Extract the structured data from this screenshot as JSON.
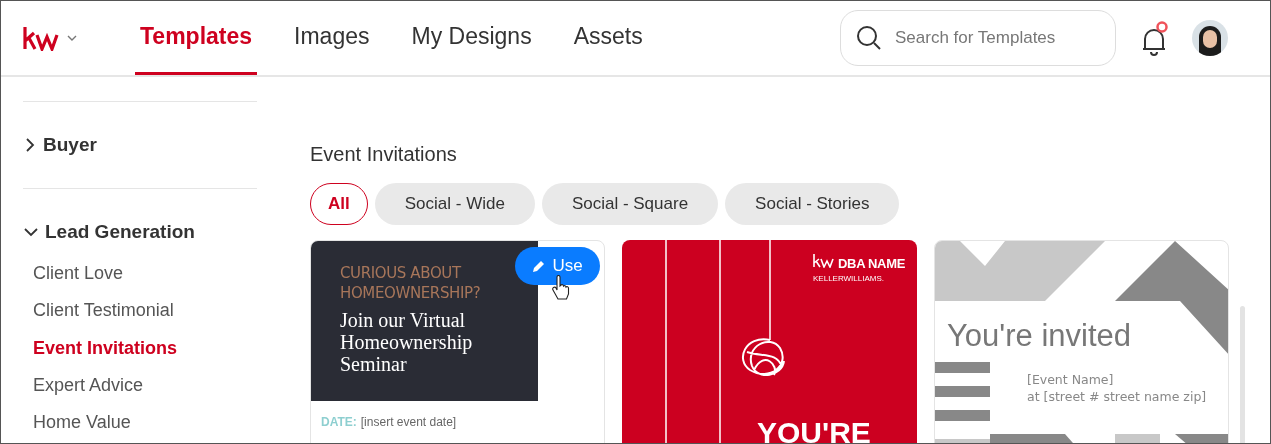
{
  "nav": {
    "tabs": [
      {
        "label": "Templates",
        "selected": true
      },
      {
        "label": "Images",
        "selected": false
      },
      {
        "label": "My Designs",
        "selected": false
      },
      {
        "label": "Assets",
        "selected": false
      }
    ],
    "search": {
      "placeholder": "Search for Templates"
    },
    "notifications": {
      "unread": true
    }
  },
  "sidebar": {
    "sections": [
      {
        "label": "Buyer",
        "expanded": false
      },
      {
        "label": "Lead Generation",
        "expanded": true,
        "children": [
          {
            "label": "Client Love",
            "selected": false
          },
          {
            "label": "Client Testimonial",
            "selected": false
          },
          {
            "label": "Event Invitations",
            "selected": true
          },
          {
            "label": "Expert Advice",
            "selected": false
          },
          {
            "label": "Home Value",
            "selected": false
          }
        ]
      }
    ]
  },
  "main": {
    "heading": "Event Invitations",
    "filters": [
      {
        "label": "All",
        "selected": true
      },
      {
        "label": "Social - Wide",
        "selected": false
      },
      {
        "label": "Social - Square",
        "selected": false
      },
      {
        "label": "Social - Stories",
        "selected": false
      }
    ],
    "cards": [
      {
        "kind": "seminar",
        "kicker": "CURIOUS ABOUT HOMEOWNERSHIP?",
        "title": "Join our Virtual Homeownership Seminar",
        "field_label": "DATE:",
        "field_value": "[insert event date]",
        "use_button": "Use"
      },
      {
        "kind": "red",
        "brand": "DBA NAME",
        "brand_sub": "KELLERWILLIAMS.",
        "headline": "YOU'RE"
      },
      {
        "kind": "grey",
        "headline": "You're invited",
        "lines": [
          "[Event Name]",
          "at [street # street name zip]"
        ]
      }
    ]
  }
}
